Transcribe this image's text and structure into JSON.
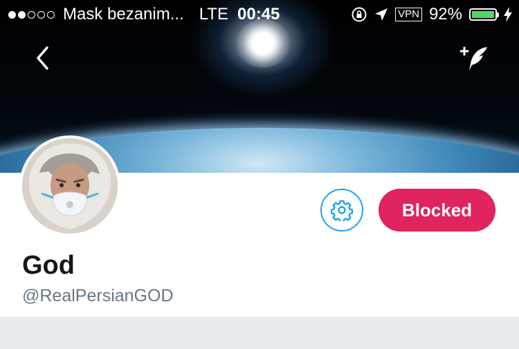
{
  "status_bar": {
    "carrier": "Mask bezanim...",
    "network": "LTE",
    "time": "00:45",
    "vpn_label": "VPN",
    "battery_percent": "92%",
    "battery_level": 0.92,
    "signal_strength": 2,
    "signal_max": 5
  },
  "header": {
    "back_icon": "chevron-left-icon",
    "compose_icon": "compose-feather-icon"
  },
  "profile": {
    "display_name": "God",
    "handle": "@RealPersianGOD",
    "blocked_label": "Blocked",
    "settings_icon": "gear-icon"
  },
  "colors": {
    "blocked_button": "#e0245e",
    "accent_blue": "#1da1f2",
    "battery_green": "#4cd964",
    "handle_gray": "#657786",
    "page_background": "#e6ecf0"
  }
}
